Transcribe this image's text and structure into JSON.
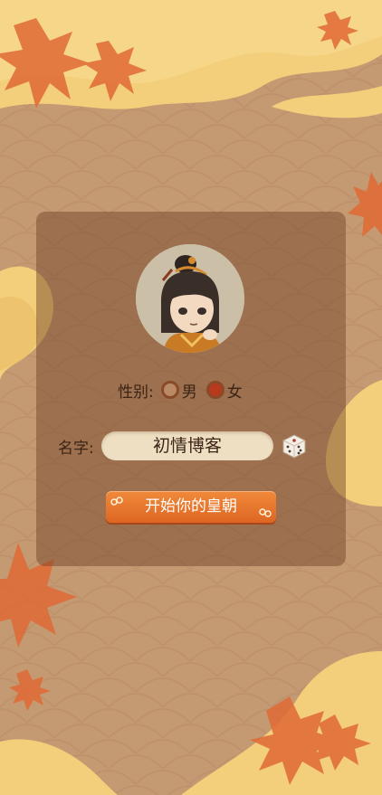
{
  "colors": {
    "background": "#c49a73",
    "panel": "#7a4a2d",
    "accent_orange": "#e8722c",
    "yellow_wave": "#f3cf7c",
    "leaf": "#e06a35",
    "text_dark": "#3c2313",
    "input_bg": "#eedfc3",
    "radio_checked": "#b73a1d"
  },
  "profile": {
    "avatar_icon": "official-character-avatar"
  },
  "gender": {
    "label": "性别:",
    "options": [
      {
        "label": "男",
        "selected": false
      },
      {
        "label": "女",
        "selected": true
      }
    ]
  },
  "name": {
    "label": "名字:",
    "value": "初情博客",
    "random_icon": "dice-icon"
  },
  "start_button": {
    "label": "开始你的皇朝"
  }
}
